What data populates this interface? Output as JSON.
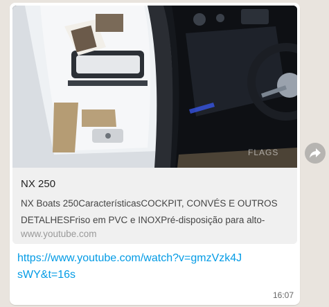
{
  "preview": {
    "title": "NX 250",
    "description": "NX Boats 250CaracterísticasCOCKPIT, CONVÉS E OUTROS DETALHESFriso em PVC e INOXPré-disposição para alto-",
    "domain": "www.youtube.com",
    "image_watermark": "FLAGS"
  },
  "message": {
    "link_text": "https://www.youtube.com/watch?v=gmzVzk4JsWY&t=16s",
    "time": "16:07"
  },
  "icons": {
    "forward": "forward-arrow-icon"
  },
  "colors": {
    "link": "#039be5",
    "bubble": "#ffffff",
    "preview_bg": "#f0f0f0",
    "chat_bg": "#e9e4de"
  }
}
